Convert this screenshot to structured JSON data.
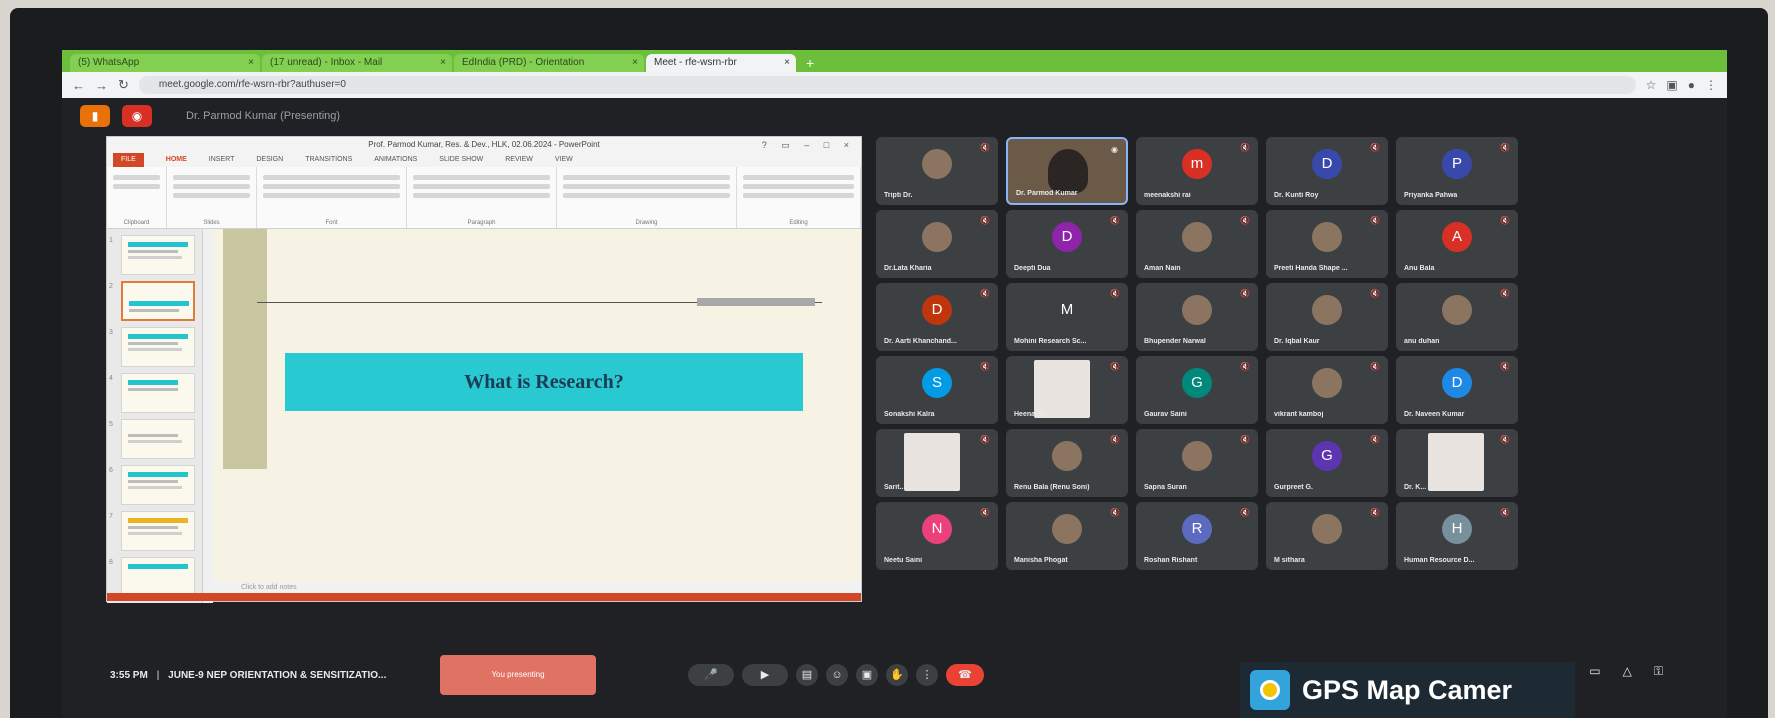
{
  "browser": {
    "tabs": [
      {
        "label": "(5) WhatsApp"
      },
      {
        "label": "(17 unread) - Inbox - Mail"
      },
      {
        "label": "EdIndia (PRD) - Orientation"
      },
      {
        "label": "Meet - rfe-wsrn-rbr"
      }
    ],
    "address": "meet.google.com/rfe-wsrn-rbr?authuser=0"
  },
  "meet": {
    "presenting_label": "Dr. Parmod Kumar (Presenting)"
  },
  "ppt": {
    "window_title": "Prof. Parmod Kumar, Res. & Dev., HLK, 02.06.2024 - PowerPoint",
    "ribbon_tabs": [
      "FILE",
      "HOME",
      "INSERT",
      "DESIGN",
      "TRANSITIONS",
      "ANIMATIONS",
      "SLIDE SHOW",
      "REVIEW",
      "VIEW"
    ],
    "ribbon_groups": [
      "Clipboard",
      "Slides",
      "Font",
      "Paragraph",
      "Drawing",
      "Editing"
    ],
    "slide_title": "What is Research?",
    "notes_placeholder": "Click to add notes",
    "slide_numbers": [
      "1",
      "2",
      "3",
      "4",
      "5",
      "6",
      "7",
      "8"
    ]
  },
  "participants": [
    {
      "name": "Tripti Dr.",
      "initial": "",
      "color": "#5f6368",
      "mic": "muted"
    },
    {
      "name": "Dr. Parmod Kumar",
      "initial": "",
      "color": "#000000",
      "mic": "speaking"
    },
    {
      "name": "meenakshi rai",
      "initial": "m",
      "color": "#d93025",
      "mic": "muted"
    },
    {
      "name": "Dr. Kunti Roy",
      "initial": "D",
      "color": "#3949ab",
      "mic": "muted"
    },
    {
      "name": "Priyanka Pahwa",
      "initial": "P",
      "color": "#3949ab",
      "mic": "muted"
    },
    {
      "name": "Dr.Lata Kharia",
      "initial": "",
      "color": "#5f6368",
      "mic": "muted"
    },
    {
      "name": "Deepti Dua",
      "initial": "D",
      "color": "#8e24aa",
      "mic": "muted"
    },
    {
      "name": "Aman Nain",
      "initial": "",
      "color": "#5f6368",
      "mic": "muted"
    },
    {
      "name": "Preeti Handa Shape ...",
      "initial": "",
      "color": "#5f6368",
      "mic": "muted"
    },
    {
      "name": "Anu Bala",
      "initial": "A",
      "color": "#d93025",
      "mic": "muted"
    },
    {
      "name": "Dr. Aarti Khanchand...",
      "initial": "D",
      "color": "#bf360c",
      "mic": "muted"
    },
    {
      "name": "Mohini Research Sc...",
      "initial": "M",
      "color": "#3c4043",
      "mic": "muted"
    },
    {
      "name": "Bhupender Narwal",
      "initial": "",
      "color": "#5f6368",
      "mic": "muted"
    },
    {
      "name": "Dr. Iqbal Kaur",
      "initial": "",
      "color": "#5f6368",
      "mic": "muted"
    },
    {
      "name": "anu duhan",
      "initial": "",
      "color": "#5f6368",
      "mic": "muted"
    },
    {
      "name": "Sonakshi Kalra",
      "initial": "S",
      "color": "#039be5",
      "mic": "muted"
    },
    {
      "name": "Heena Sh...",
      "initial": "",
      "color": "#5f6368",
      "mic": "muted"
    },
    {
      "name": "Gaurav Saini",
      "initial": "G",
      "color": "#00897b",
      "mic": "muted"
    },
    {
      "name": "vikrant kamboj",
      "initial": "",
      "color": "#5f6368",
      "mic": "muted"
    },
    {
      "name": "Dr. Naveen Kumar",
      "initial": "D",
      "color": "#1e88e5",
      "mic": "muted"
    },
    {
      "name": "Sarit...",
      "initial": "",
      "color": "#5f6368",
      "mic": "muted"
    },
    {
      "name": "Renu Bala (Renu Soni)",
      "initial": "",
      "color": "#5f6368",
      "mic": "muted"
    },
    {
      "name": "Sapna Suran",
      "initial": "",
      "color": "#5f6368",
      "mic": "muted"
    },
    {
      "name": "Gurpreet G.",
      "initial": "G",
      "color": "#5e35b1",
      "mic": "muted"
    },
    {
      "name": "Dr. K...",
      "initial": "",
      "color": "#5f6368",
      "mic": "muted"
    },
    {
      "name": "Neetu Saini",
      "initial": "N",
      "color": "#ec407a",
      "mic": "muted"
    },
    {
      "name": "Manisha Phogat",
      "initial": "",
      "color": "#5f6368",
      "mic": "muted"
    },
    {
      "name": "Roshan Rishant",
      "initial": "R",
      "color": "#5c6bc0",
      "mic": "muted"
    },
    {
      "name": "M sithara",
      "initial": "",
      "color": "#5f6368",
      "mic": "muted"
    },
    {
      "name": "Human Resource D...",
      "initial": "H",
      "color": "#78909c",
      "mic": "muted"
    }
  ],
  "bottom": {
    "time": "3:55 PM",
    "separator": "|",
    "meeting_title": "JUNE-9 NEP ORIENTATION & SENSITIZATIO...",
    "present_chip": "You presenting"
  },
  "watermark": {
    "text": "GPS Map Camer"
  }
}
